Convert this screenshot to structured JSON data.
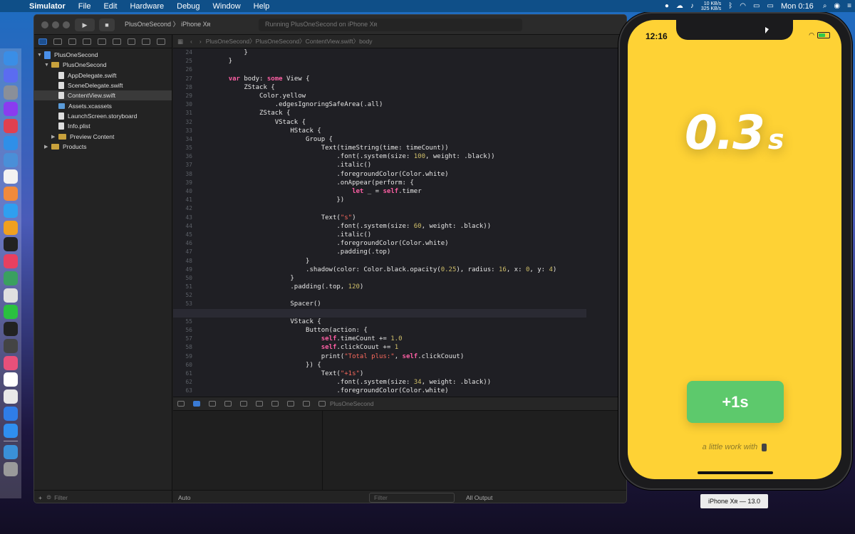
{
  "menubar": {
    "app_name": "Simulator",
    "items": [
      "File",
      "Edit",
      "Hardware",
      "Debug",
      "Window",
      "Help"
    ],
    "net_up": "10 KB/s",
    "net_down": "325 KB/s",
    "clock": "Mon 0:16"
  },
  "xcode": {
    "scheme": "PlusOneSecond",
    "device": "iPhone Xʀ",
    "status": "Running PlusOneSecond on iPhone Xʀ",
    "jumpbar": [
      "PlusOneSecond",
      "PlusOneSecond",
      "ContentView.swift",
      "body"
    ],
    "navigator": {
      "project": "PlusOneSecond",
      "group": "PlusOneSecond",
      "files": [
        "AppDelegate.swift",
        "SceneDelegate.swift",
        "ContentView.swift",
        "Assets.xcassets",
        "LaunchScreen.storyboard",
        "Info.plist"
      ],
      "preview_content": "Preview Content",
      "products": "Products",
      "filter_placeholder": "Filter"
    },
    "line_numbers": [
      "24",
      "25",
      "26",
      "27",
      "28",
      "29",
      "30",
      "31",
      "32",
      "33",
      "34",
      "35",
      "36",
      "37",
      "38",
      "39",
      "40",
      "41",
      "42",
      "43",
      "44",
      "45",
      "46",
      "47",
      "48",
      "49",
      "50",
      "51",
      "52",
      "53",
      "54",
      "55",
      "56",
      "57",
      "58",
      "59",
      "60",
      "61",
      "62",
      "63"
    ],
    "debug": {
      "target": "PlusOneSecond",
      "variables_mode": "Auto",
      "filter_placeholder": "Filter",
      "output_mode": "All Output",
      "console_filter": "Filter"
    }
  },
  "simulator": {
    "status_time": "12:16",
    "counter_value": "0.3",
    "counter_unit": "s",
    "button_label": "+1s",
    "credit": "a little work with",
    "device_label": "iPhone Xʀ — 13.0",
    "screen_color": "#fed235",
    "button_color": "#5dc96c"
  },
  "colors": {
    "menubar": "#0f4f88",
    "editor_bg": "#1f1f24",
    "keyword": "#fc5fa3",
    "string": "#fc6a5d",
    "number": "#d0bf69"
  }
}
